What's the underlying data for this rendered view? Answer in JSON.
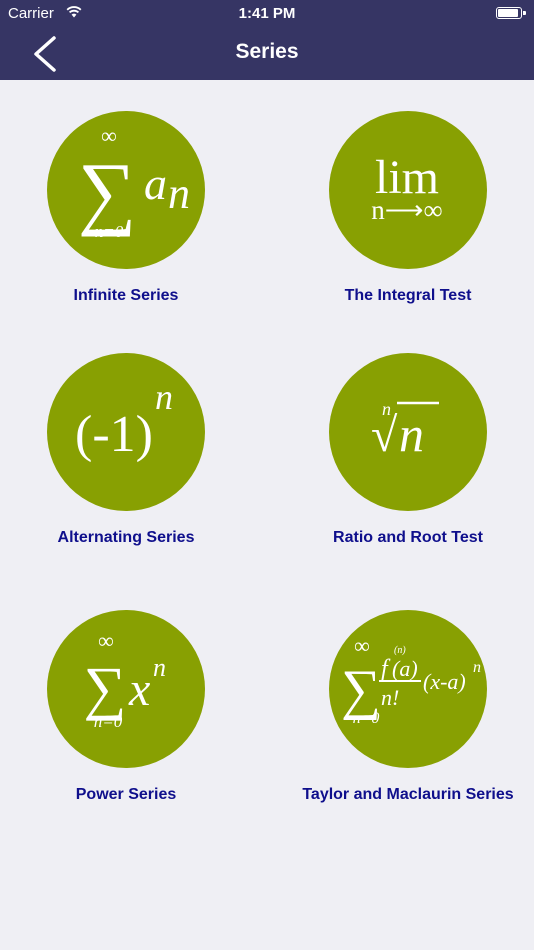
{
  "status_bar": {
    "carrier": "Carrier",
    "time": "1:41 PM"
  },
  "nav": {
    "title": "Series"
  },
  "tiles": [
    {
      "label": "Infinite Series",
      "icon": "sum-an-formula-icon"
    },
    {
      "label": "The Integral Test",
      "icon": "limit-formula-icon"
    },
    {
      "label": "Alternating Series",
      "icon": "neg-one-power-formula-icon"
    },
    {
      "label": "Ratio and Root Test",
      "icon": "nth-root-formula-icon"
    },
    {
      "label": "Power Series",
      "icon": "sum-xn-formula-icon"
    },
    {
      "label": "Taylor and Maclaurin Series",
      "icon": "taylor-formula-icon"
    }
  ],
  "formulas": {
    "infinite_series": {
      "upper": "∞",
      "sigma": "∑",
      "term": "a",
      "sub": "n",
      "lower": "n=0"
    },
    "integral_test": {
      "lim": "lim",
      "under": "n⟶∞"
    },
    "alternating": {
      "base": "(-1)",
      "exp": "n"
    },
    "ratio_root": {
      "index": "n",
      "radical": "√",
      "radicand": "n"
    },
    "power": {
      "upper": "∞",
      "sigma": "∑",
      "term": "x",
      "exp": "n",
      "lower": "n=0"
    },
    "taylor": {
      "upper": "∞",
      "sigma": "∑",
      "num": "f",
      "num_sup": "(n)",
      "num_arg": "(a)",
      "den": "n!",
      "factor": "(x-a)",
      "exp": "n",
      "lower": "n=0"
    }
  },
  "colors": {
    "nav_bg": "#363564",
    "circle": "#88a002",
    "label": "#0f0f8c",
    "page_bg": "#efeff4"
  }
}
